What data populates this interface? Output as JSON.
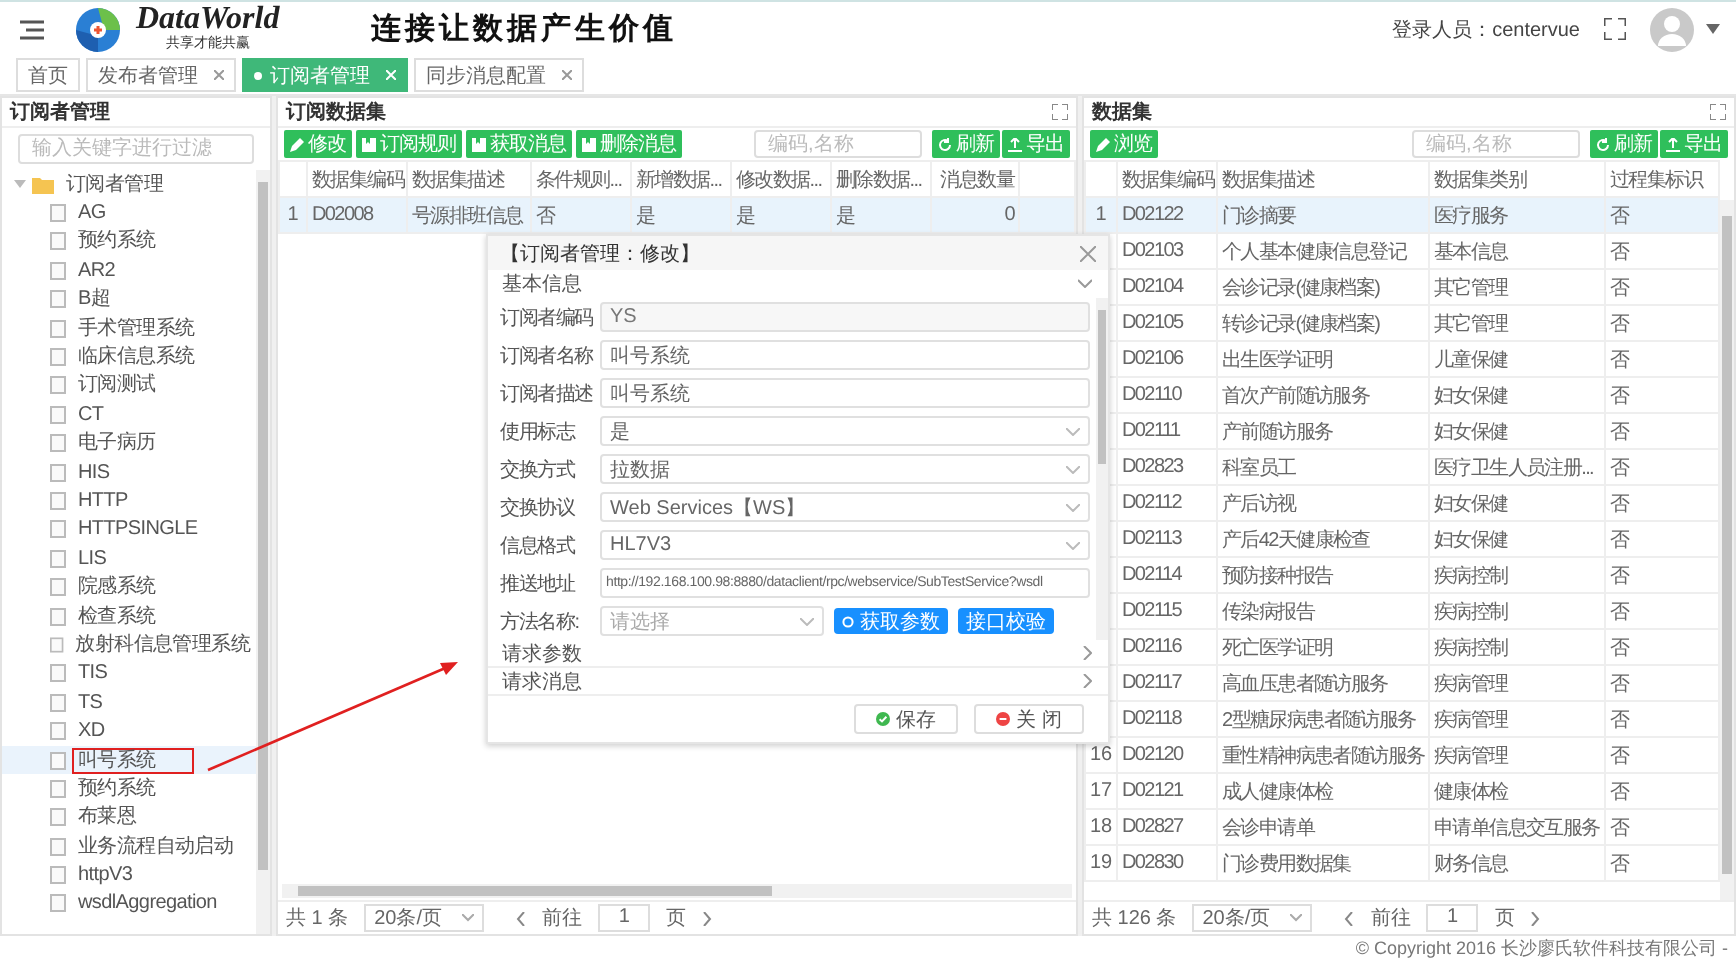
{
  "header": {
    "brand": "DataWorld",
    "tagline": "共享才能共赢",
    "slogan": "连接让数据产生价值",
    "user_label": "登录人员：centervue"
  },
  "tabs": [
    {
      "label": "首页",
      "selected": false,
      "closable": false
    },
    {
      "label": "发布者管理",
      "selected": false,
      "closable": true
    },
    {
      "label": "订阅者管理",
      "selected": true,
      "closable": true
    },
    {
      "label": "同步消息配置",
      "selected": false,
      "closable": true
    }
  ],
  "subscriber_panel": {
    "title": "订阅者管理",
    "filter_placeholder": "输入关键字进行过滤",
    "tree": [
      {
        "label": "订阅者管理",
        "expanded": true,
        "selected": false,
        "marked": false,
        "children": [
          {
            "label": "AG",
            "selected": false,
            "marked": false
          },
          {
            "label": "预约系统",
            "selected": false,
            "marked": false
          },
          {
            "label": "AR2",
            "selected": false,
            "marked": false
          },
          {
            "label": "B超",
            "selected": false,
            "marked": false
          },
          {
            "label": "手术管理系统",
            "selected": false,
            "marked": false
          },
          {
            "label": "临床信息系统",
            "selected": false,
            "marked": false
          },
          {
            "label": "订阅测试",
            "selected": false,
            "marked": false
          },
          {
            "label": "CT",
            "selected": false,
            "marked": false
          },
          {
            "label": "电子病历",
            "selected": false,
            "marked": false
          },
          {
            "label": "HIS",
            "selected": false,
            "marked": false
          },
          {
            "label": "HTTP",
            "selected": false,
            "marked": false
          },
          {
            "label": "HTTPSINGLE",
            "selected": false,
            "marked": false
          },
          {
            "label": "LIS",
            "selected": false,
            "marked": false
          },
          {
            "label": "院感系统",
            "selected": false,
            "marked": false
          },
          {
            "label": "检查系统",
            "selected": false,
            "marked": false
          },
          {
            "label": "放射科信息管理系统",
            "selected": false,
            "marked": false
          },
          {
            "label": "TIS",
            "selected": false,
            "marked": false
          },
          {
            "label": "TS",
            "selected": false,
            "marked": false
          },
          {
            "label": "XD",
            "selected": false,
            "marked": false
          },
          {
            "label": "叫号系统",
            "selected": true,
            "marked": true
          },
          {
            "label": "预约系统",
            "selected": false,
            "marked": false
          },
          {
            "label": "布莱恩",
            "selected": false,
            "marked": false
          },
          {
            "label": "业务流程自动启动",
            "selected": false,
            "marked": false
          },
          {
            "label": "httpV3",
            "selected": false,
            "marked": false
          },
          {
            "label": "wsdlAggregation",
            "selected": false,
            "marked": false
          }
        ]
      }
    ]
  },
  "subscribed_panel": {
    "title": "订阅数据集",
    "buttons": [
      {
        "label": "修改",
        "kind": "edit"
      },
      {
        "label": "订阅规则",
        "kind": "doc"
      },
      {
        "label": "获取消息",
        "kind": "doc"
      },
      {
        "label": "删除消息",
        "kind": "doc"
      }
    ],
    "search_placeholder": "编码,名称",
    "actions": [
      {
        "label": "刷新",
        "kind": "refresh"
      },
      {
        "label": "导出",
        "kind": "export"
      }
    ],
    "columns": [
      "数据集编码",
      "数据集描述",
      "条件规则...",
      "新增数据...",
      "修改数据...",
      "删除数据...",
      "消息数量"
    ],
    "rows": [
      {
        "index": "1",
        "cells": [
          "D02008",
          "号源排班信息",
          "否",
          "是",
          "是",
          "是",
          "0"
        ],
        "selected": true
      }
    ],
    "pagination": {
      "total": "共 1 条",
      "page_size": "20条/页",
      "goto": "前往",
      "page": "1",
      "page_unit": "页"
    }
  },
  "dataset_panel": {
    "title": "数据集",
    "buttons": [
      {
        "label": "浏览",
        "kind": "edit"
      }
    ],
    "search_placeholder": "编码,名称",
    "actions": [
      {
        "label": "刷新",
        "kind": "refresh"
      },
      {
        "label": "导出",
        "kind": "export"
      }
    ],
    "columns": [
      "数据集编码",
      "数据集描述",
      "数据集类别",
      "过程集标识"
    ],
    "rows": [
      {
        "index": "1",
        "cells": [
          "D02122",
          "门诊摘要",
          "医疗服务",
          "否"
        ],
        "selected": true
      },
      {
        "cells": [
          "D02103",
          "个人基本健康信息登记",
          "基本信息",
          "否"
        ],
        "selected": false
      },
      {
        "cells": [
          "D02104",
          "会诊记录(健康档案)",
          "其它管理",
          "否"
        ],
        "selected": false
      },
      {
        "cells": [
          "D02105",
          "转诊记录(健康档案)",
          "其它管理",
          "否"
        ],
        "selected": false
      },
      {
        "cells": [
          "D02106",
          "出生医学证明",
          "儿童保健",
          "否"
        ],
        "selected": false
      },
      {
        "cells": [
          "D02110",
          "首次产前随访服务",
          "妇女保健",
          "否"
        ],
        "selected": false
      },
      {
        "cells": [
          "D02111",
          "产前随访服务",
          "妇女保健",
          "否"
        ],
        "selected": false
      },
      {
        "cells": [
          "D02823",
          "科室员工",
          "医疗卫生人员注册...",
          "否"
        ],
        "selected": false
      },
      {
        "cells": [
          "D02112",
          "产后访视",
          "妇女保健",
          "否"
        ],
        "selected": false
      },
      {
        "cells": [
          "D02113",
          "产后42天健康检查",
          "妇女保健",
          "否"
        ],
        "selected": false
      },
      {
        "cells": [
          "D02114",
          "预防接种报告",
          "疾病控制",
          "否"
        ],
        "selected": false
      },
      {
        "cells": [
          "D02115",
          "传染病报告",
          "疾病控制",
          "否"
        ],
        "selected": false
      },
      {
        "cells": [
          "D02116",
          "死亡医学证明",
          "疾病控制",
          "否"
        ],
        "selected": false
      },
      {
        "cells": [
          "D02117",
          "高血压患者随访服务",
          "疾病管理",
          "否"
        ],
        "selected": false
      },
      {
        "cells": [
          "D02118",
          "2型糖尿病患者随访服务",
          "疾病管理",
          "否"
        ],
        "selected": false
      },
      {
        "index": "16",
        "cells": [
          "D02120",
          "重性精神病患者随访服务",
          "疾病管理",
          "否"
        ],
        "selected": false
      },
      {
        "index": "17",
        "cells": [
          "D02121",
          "成人健康体检",
          "健康体检",
          "否"
        ],
        "selected": false
      },
      {
        "index": "18",
        "cells": [
          "D02827",
          "会诊申请单",
          "申请单信息交互服务",
          "否"
        ],
        "selected": false
      },
      {
        "index": "19",
        "cells": [
          "D02830",
          "门诊费用数据集",
          "财务信息",
          "否"
        ],
        "selected": false
      }
    ],
    "pagination": {
      "total": "共 126 条",
      "page_size": "20条/页",
      "goto": "前往",
      "page": "1",
      "page_unit": "页"
    }
  },
  "dialog": {
    "title": "【订阅者管理：修改】",
    "sections": [
      {
        "title": "基本信息",
        "expanded": true,
        "fields": [
          {
            "label": "订阅者编码",
            "kind": "input",
            "value": "YS",
            "disabled": true
          },
          {
            "label": "订阅者名称",
            "kind": "input",
            "value": "叫号系统",
            "disabled": false
          },
          {
            "label": "订阅者描述",
            "kind": "input",
            "value": "叫号系统",
            "disabled": false
          },
          {
            "label": "使用标志",
            "kind": "select",
            "value": "是",
            "disabled": false
          },
          {
            "label": "交换方式",
            "kind": "select",
            "value": "拉数据",
            "disabled": false
          },
          {
            "label": "交换协议",
            "kind": "select",
            "value": "Web Services【WS】",
            "disabled": false
          },
          {
            "label": "信息格式",
            "kind": "select",
            "value": "HL7V3",
            "disabled": false
          },
          {
            "label": "推送地址",
            "kind": "input",
            "value": "http://192.168.100.98:8880/dataclient/rpc/webservice/SubTestService?wsdl",
            "disabled": false
          },
          {
            "label": "方法名称:",
            "kind": "method",
            "placeholder": "请选择",
            "disabled": false,
            "buttons": [
              "获取参数",
              "接口校验"
            ]
          }
        ]
      },
      {
        "title": "请求参数",
        "expanded": false
      },
      {
        "title": "请求消息",
        "expanded": false
      }
    ],
    "buttons": [
      {
        "label": "保存",
        "kind": "save"
      },
      {
        "label": "关 闭",
        "kind": "close"
      }
    ]
  },
  "copyright": "© Copyright 2016 长沙廖氏软件科技有限公司 -"
}
